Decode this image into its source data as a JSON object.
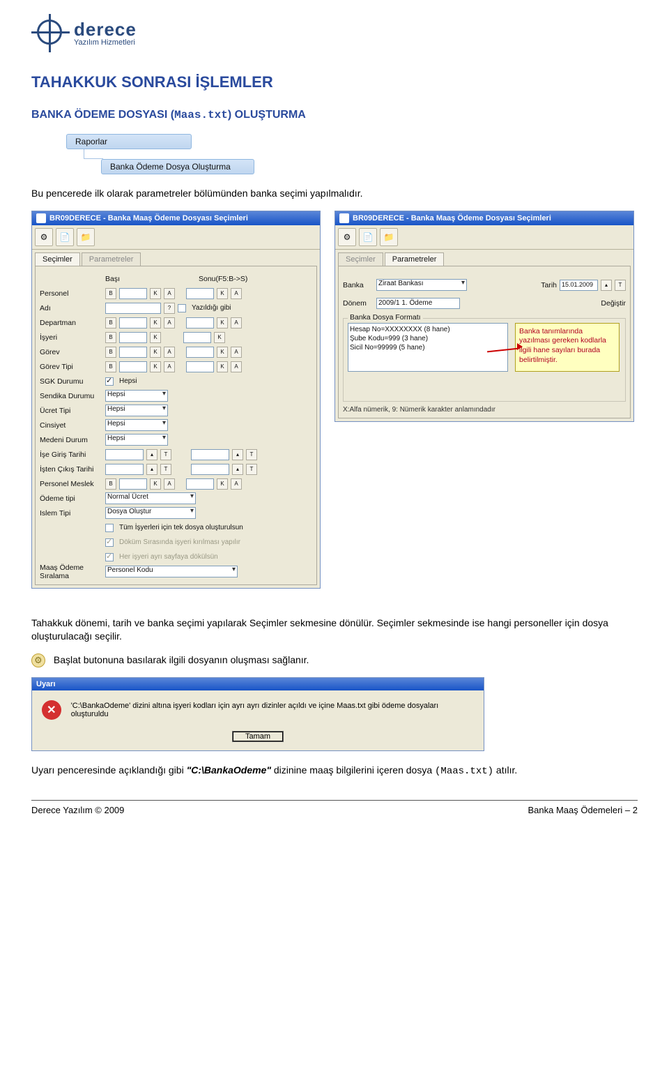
{
  "logo": {
    "title": "derece",
    "subtitle": "Yazılım Hizmetleri"
  },
  "heading1": "TAHAKKUK SONRASI İŞLEMLER",
  "heading2_prefix": "BANKA ÖDEME DOSYASI (",
  "heading2_mono": "Maas.txt",
  "heading2_suffix": ") OLUŞTURMA",
  "breadcrumb": {
    "level1": "Raporlar",
    "level2": "Banka Ödeme Dosya Oluşturma"
  },
  "intro": "Bu pencerede ilk olarak parametreler bölümünden banka seçimi yapılmalıdır.",
  "win_title": "BR09DERECE - Banka Maaş Ödeme Dosyası Seçimleri",
  "tabs": {
    "secimler": "Seçimler",
    "parametreler": "Parametreler"
  },
  "left_form": {
    "head_basi": "Başı",
    "head_sonu": "Sonu(F5:B->S)",
    "personel": "Personel",
    "adi": "Adı",
    "departman": "Departman",
    "isyeri": "İşyeri",
    "gorev": "Görev",
    "gorev_tipi": "Görev Tipi",
    "sgk_durumu": "SGK Durumu",
    "sendika_durumu": "Sendika Durumu",
    "ucret_tipi": "Ücret Tipi",
    "cinsiyet": "Cinsiyet",
    "medeni_durum": "Medeni Durum",
    "ise_giris": "İşe Giriş Tarihi",
    "isten_cikis": "İşten Çıkış Tarihi",
    "personel_meslek": "Personel Meslek",
    "odeme_tipi": "Ödeme tipi",
    "islem_tipi": "Islem Tipi",
    "maas_siralama": "Maaş Ödeme Sıralama",
    "b": "B",
    "k": "K",
    "a": "A",
    "q": "?",
    "yazildigi_gibi": "Yazıldığı gibi",
    "hepsi": "Hepsi",
    "normal_ucret": "Normal Ücret",
    "dosya_olustur": "Dosya Oluştur",
    "personel_kodu": "Personel Kodu",
    "chk1": "Tüm İşyerleri için tek dosya oluşturulsun",
    "chk2": "Döküm Sırasında işyeri kırılması yapılır",
    "chk3": "Her işyeri ayrı sayfaya dökülsün",
    "t": "T"
  },
  "right_form": {
    "banka_label": "Banka",
    "banka_value": "Ziraat Bankası",
    "tarih_label": "Tarih",
    "tarih_value": "15.01.2009",
    "donem_label": "Dönem",
    "donem_value": "2009/1 1. Ödeme",
    "degistir": "Değiştir",
    "group_title": "Banka Dosya Formatı",
    "list1": "Hesap No=XXXXXXXX (8 hane)",
    "list2": "Şube Kodu=999 (3 hane)",
    "list3": "Sicil No=99999 (5 hane)",
    "callout": "Banka tanımlarında yazılması gereken kodlarla ilgili hane sayıları burada belirtilmiştir.",
    "footnote": "X:Alfa nümerik, 9: Nümerik karakter anlamındadır",
    "t": "T"
  },
  "para1": "Tahakkuk dönemi, tarih ve banka seçimi yapılarak Seçimler sekmesine dönülür. Seçimler sekmesinde ise hangi personeller için dosya oluşturulacağı seçilir.",
  "para2": "Başlat butonuna basılarak ilgili dosyanın oluşması sağlanır.",
  "uyari": {
    "title": "Uyarı",
    "text": "'C:\\BankaOdeme' dizini altına işyeri kodları için ayrı ayrı dizinler açıldı ve içine Maas.txt gibi ödeme dosyaları oluşturuldu",
    "ok": "Tamam"
  },
  "para3_pre": "Uyarı penceresinde açıklandığı gibi ",
  "para3_bold": "\"C:\\BankaOdeme\"",
  "para3_mid": " dizinine maaş bilgilerini içeren dosya ",
  "para3_mono": "(Maas.txt)",
  "para3_post": " atılır.",
  "footer": {
    "left": "Derece Yazılım © 2009",
    "right": "Banka Maaş Ödemeleri – 2"
  }
}
